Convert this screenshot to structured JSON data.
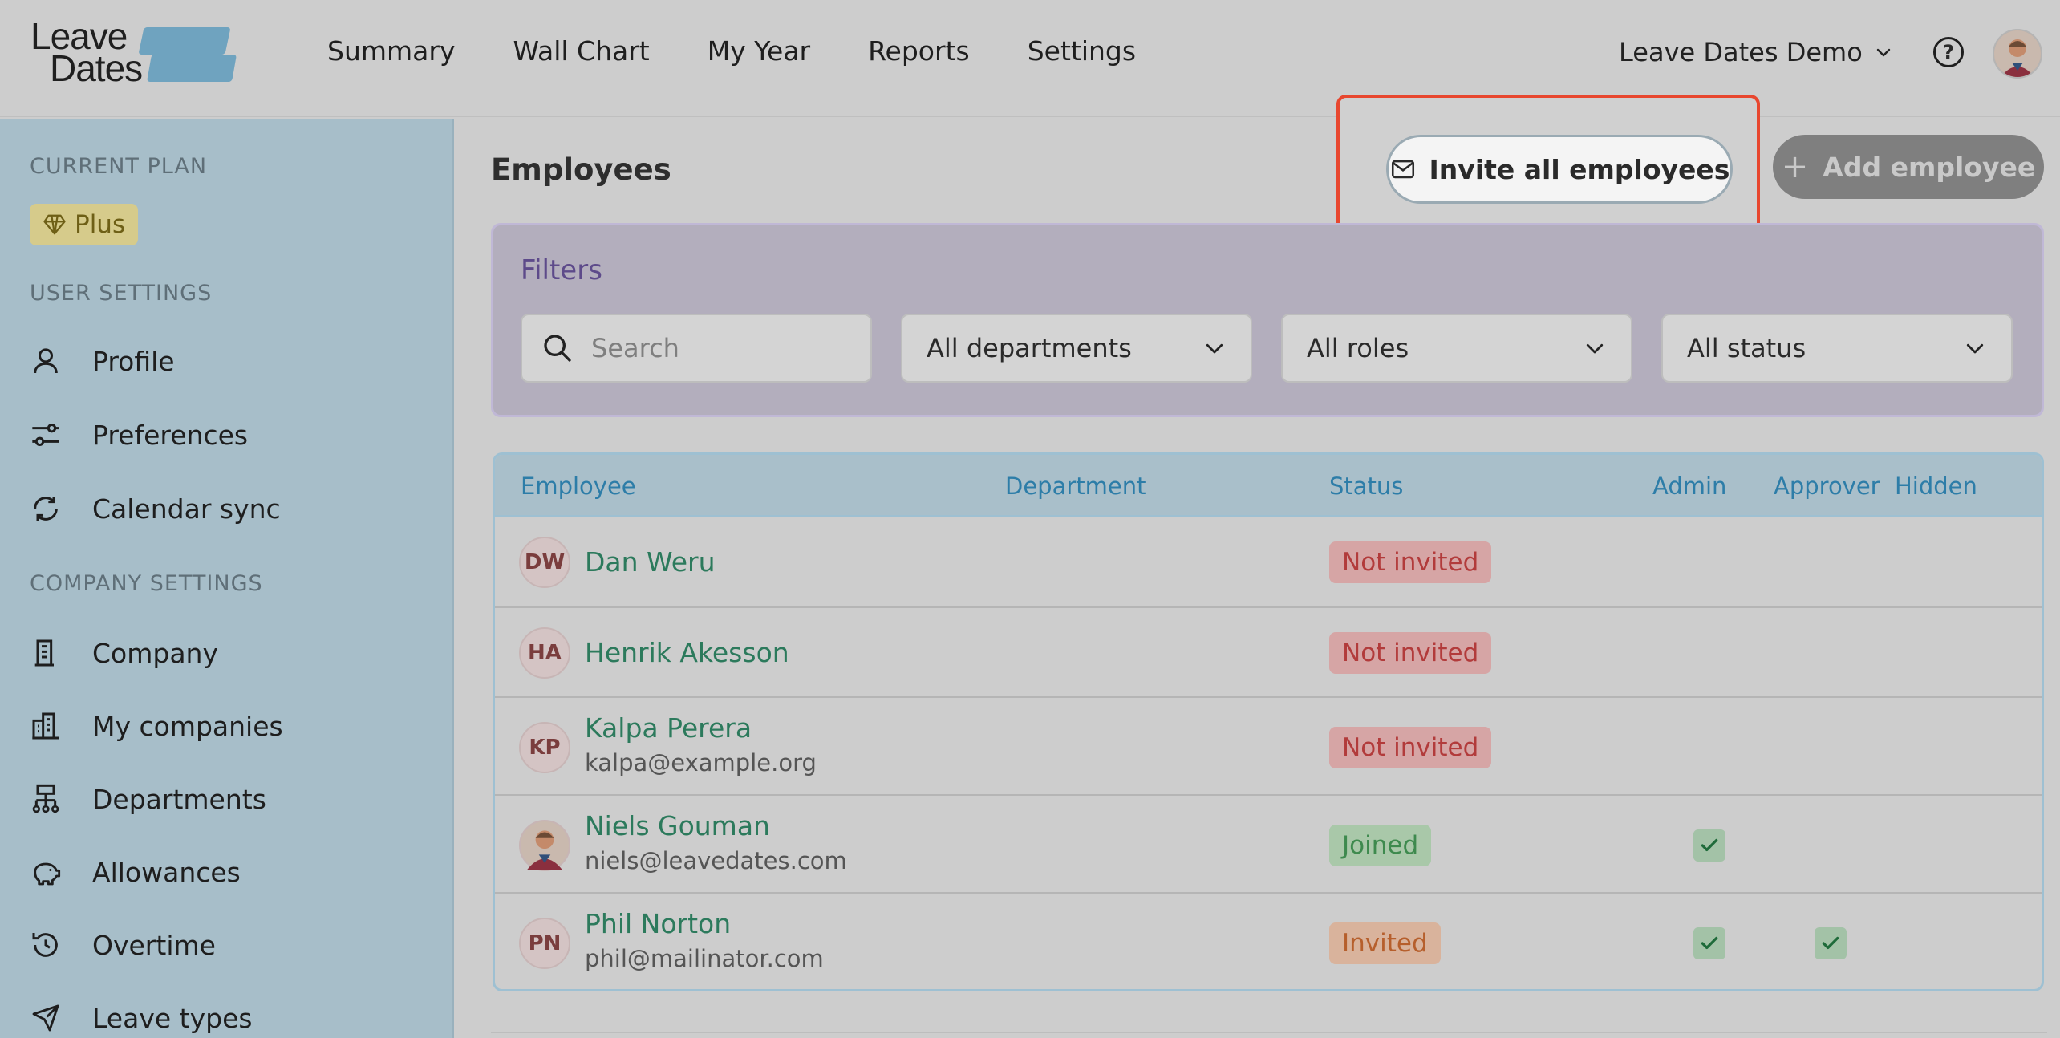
{
  "header": {
    "logo_line1": "Leave",
    "logo_line2": "Dates",
    "nav": [
      "Summary",
      "Wall Chart",
      "My Year",
      "Reports",
      "Settings"
    ],
    "company_name": "Leave Dates Demo"
  },
  "sidebar": {
    "current_plan_label": "CURRENT PLAN",
    "plan_name": "Plus",
    "user_settings_label": "USER SETTINGS",
    "user_items": [
      {
        "label": "Profile",
        "icon": "person-icon"
      },
      {
        "label": "Preferences",
        "icon": "sliders-icon"
      },
      {
        "label": "Calendar sync",
        "icon": "sync-icon"
      }
    ],
    "company_settings_label": "COMPANY SETTINGS",
    "company_items": [
      {
        "label": "Company",
        "icon": "building-icon"
      },
      {
        "label": "My companies",
        "icon": "buildings-icon"
      },
      {
        "label": "Departments",
        "icon": "org-chart-icon"
      },
      {
        "label": "Allowances",
        "icon": "piggy-bank-icon"
      },
      {
        "label": "Overtime",
        "icon": "clock-history-icon"
      },
      {
        "label": "Leave types",
        "icon": "plane-icon"
      }
    ]
  },
  "main": {
    "title": "Employees",
    "invite_all_label": "Invite all employees",
    "add_employee_label": "Add employee",
    "filters": {
      "title": "Filters",
      "search_placeholder": "Search",
      "department": "All departments",
      "role": "All roles",
      "status": "All status"
    },
    "table": {
      "columns": [
        "Employee",
        "Department",
        "Status",
        "Admin",
        "Approver",
        "Hidden"
      ],
      "rows": [
        {
          "initials": "DW",
          "name": "Dan Weru",
          "email": "",
          "status": "Not invited",
          "admin": false,
          "approver": false,
          "hidden": false
        },
        {
          "initials": "HA",
          "name": "Henrik Akesson",
          "email": "",
          "status": "Not invited",
          "admin": false,
          "approver": false,
          "hidden": false
        },
        {
          "initials": "KP",
          "name": "Kalpa Perera",
          "email": "kalpa@example.org",
          "status": "Not invited",
          "admin": false,
          "approver": false,
          "hidden": false
        },
        {
          "initials": "",
          "name": "Niels Gouman",
          "email": "niels@leavedates.com",
          "status": "Joined",
          "admin": true,
          "approver": false,
          "hidden": false
        },
        {
          "initials": "PN",
          "name": "Phil Norton",
          "email": "phil@mailinator.com",
          "status": "Invited",
          "admin": true,
          "approver": true,
          "hidden": false
        }
      ]
    }
  },
  "colors": {
    "highlight": "#e8472f",
    "employee_name": "#2c7a5c",
    "table_header_text": "#2d7da8",
    "filters_title": "#5d4a8a"
  }
}
